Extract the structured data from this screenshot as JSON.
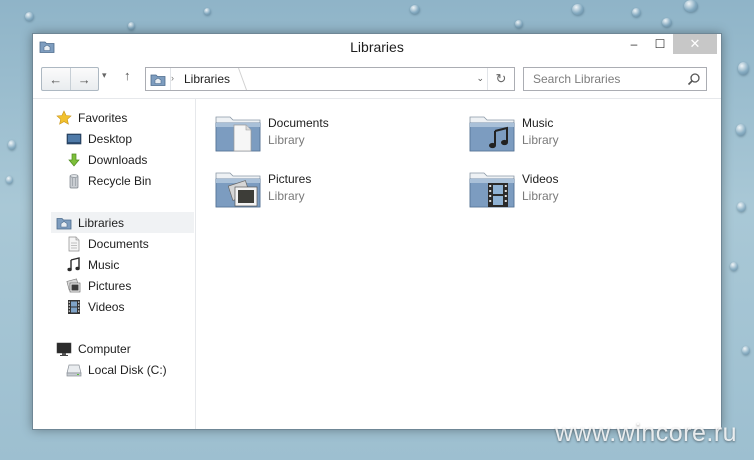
{
  "window": {
    "title": "Libraries",
    "caption": {
      "minimize": "–",
      "maximize": "☐",
      "close": "✕"
    }
  },
  "navbar": {
    "back_icon": "←",
    "forward_icon": "→",
    "recent_icon": "▾",
    "up_icon": "↑",
    "breadcrumb": "Libraries",
    "dropdown_icon": "⌄",
    "refresh_icon": "↻",
    "search_placeholder": "Search Libraries"
  },
  "sidebar": {
    "favorites": {
      "label": "Favorites",
      "items": [
        "Desktop",
        "Downloads",
        "Recycle Bin"
      ]
    },
    "libraries": {
      "label": "Libraries",
      "items": [
        "Documents",
        "Music",
        "Pictures",
        "Videos"
      ]
    },
    "computer": {
      "label": "Computer",
      "items": [
        "Local Disk (C:)"
      ]
    }
  },
  "libraries": [
    {
      "name": "Documents",
      "type": "Library",
      "icon": "documents-library-icon"
    },
    {
      "name": "Music",
      "type": "Library",
      "icon": "music-library-icon"
    },
    {
      "name": "Pictures",
      "type": "Library",
      "icon": "pictures-library-icon"
    },
    {
      "name": "Videos",
      "type": "Library",
      "icon": "videos-library-icon"
    }
  ],
  "watermark": "www.wincore.ru",
  "colors": {
    "folder": "#6f93bd",
    "accent": "#3a6ea5",
    "star": "#f2c12e"
  }
}
